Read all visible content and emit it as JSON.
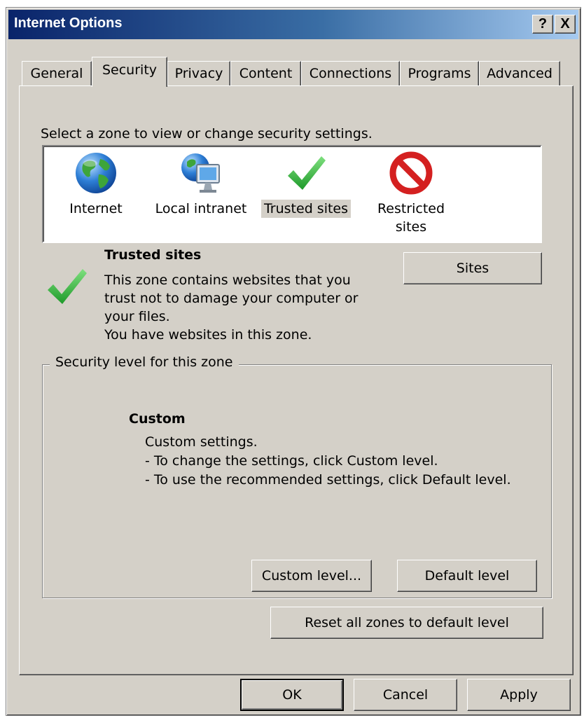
{
  "window": {
    "title": "Internet Options",
    "help_glyph": "?",
    "close_glyph": "X"
  },
  "tabs": [
    {
      "label": "General"
    },
    {
      "label": "Security",
      "active": true
    },
    {
      "label": "Privacy"
    },
    {
      "label": "Content"
    },
    {
      "label": "Connections"
    },
    {
      "label": "Programs"
    },
    {
      "label": "Advanced"
    }
  ],
  "security": {
    "zone_prompt": "Select a zone to view or change security settings.",
    "zones": [
      {
        "label": "Internet",
        "icon": "globe-icon"
      },
      {
        "label": "Local intranet",
        "icon": "intranet-monitor-globe-icon"
      },
      {
        "label": "Trusted sites",
        "icon": "checkmark-icon",
        "selected": true
      },
      {
        "label": "Restricted\nsites",
        "icon": "restricted-circle-icon"
      }
    ],
    "selected_zone": {
      "title": "Trusted sites",
      "description_lines": [
        "This zone contains websites that you",
        "trust not to damage your computer or",
        "your files.",
        "You have websites in this zone."
      ]
    },
    "sites_button": "Sites",
    "level_group": {
      "legend": "Security level for this zone",
      "level_name": "Custom",
      "description_lines": [
        "Custom settings.",
        "- To change the settings, click Custom level.",
        "- To use the recommended settings, click Default level."
      ],
      "custom_level_button": "Custom level...",
      "default_level_button": "Default level"
    },
    "reset_button": "Reset all zones to default level"
  },
  "footer": {
    "ok": "OK",
    "cancel": "Cancel",
    "apply": "Apply"
  },
  "colors": {
    "face": "#d4d0c8",
    "title_start": "#0a246a",
    "title_end": "#a6caf0",
    "check_green": "#2fb03a",
    "restricted_red": "#d42020"
  }
}
